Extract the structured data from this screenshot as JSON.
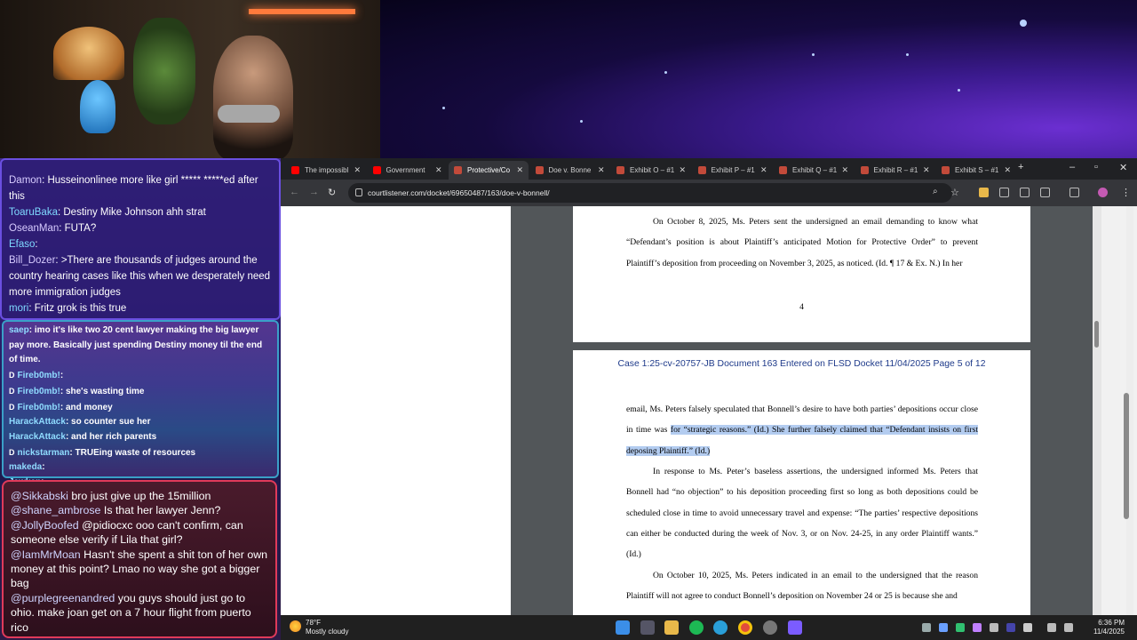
{
  "chat": {
    "top": [
      {
        "user": "Damon",
        "msg": "Husseinonlinee more like girl ***** *****ed after this"
      },
      {
        "user": "ToaruBaka",
        "msg": "Destiny Mike Johnson ahh strat"
      },
      {
        "user": "OseanMan",
        "msg": "FUTA?"
      },
      {
        "user": "Efaso",
        "msg": ""
      },
      {
        "user": "Bill_Dozer",
        "msg": ">There are thousands of judges around the country hearing cases like this when we desperately need more immigration judges"
      },
      {
        "user": "mori",
        "msg": "Fritz grok is this true"
      }
    ],
    "mid": [
      {
        "user": "saep",
        "msg": "imo it's like two 20 cent lawyer making the big lawyer pay more. Basically just spending Destiny money til the end of time.",
        "badge": ""
      },
      {
        "user": "Fireb0mb!",
        "msg": "",
        "badge": "D"
      },
      {
        "user": "Fireb0mb!",
        "msg": "she's wasting time",
        "badge": "D"
      },
      {
        "user": "Fireb0mb!",
        "msg": "and money",
        "badge": "D"
      },
      {
        "user": "HarackAttack",
        "msg": "so counter sue her",
        "badge": ""
      },
      {
        "user": "HarackAttack",
        "msg": "and her rich parents",
        "badge": ""
      },
      {
        "user": "nickstarman",
        "msg": "TRUEing waste of resources",
        "badge": "D"
      },
      {
        "user": "makeda",
        "msg": "",
        "badge": ""
      },
      {
        "user": "Jawken",
        "msg": "",
        "badge": ""
      }
    ],
    "bottom": [
      {
        "user": "@Sikkabski",
        "msg": "bro just give up the 15million"
      },
      {
        "user": "@shane_ambrose",
        "msg": "Is that her lawyer Jenn?"
      },
      {
        "user": "@JollyBoofed",
        "msg": "@pidiocxc ooo can't confirm, can someone else verify if Lila that girl?"
      },
      {
        "user": "@IamMrMoan",
        "msg": "Hasn't she spent a shit ton of her own money at this point? Lmao no way she got a bigger bag"
      },
      {
        "user": "@purplegreenandred",
        "msg": "you guys should just go to ohio. make joan get on a 7 hour flight from puerto rico"
      }
    ]
  },
  "browser": {
    "tabs": [
      {
        "title": "The impossibl",
        "icon": "youtube-icon",
        "color": "#ff0000",
        "active": false
      },
      {
        "title": "Government",
        "icon": "youtube-icon",
        "color": "#ff0000",
        "active": false
      },
      {
        "title": "Protective/Co",
        "icon": "courtlistener-icon",
        "color": "#c24a3a",
        "active": true
      },
      {
        "title": "Doe v. Bonne",
        "icon": "courtlistener-icon",
        "color": "#c24a3a",
        "active": false
      },
      {
        "title": "Exhibit O – #1",
        "icon": "courtlistener-icon",
        "color": "#c24a3a",
        "active": false
      },
      {
        "title": "Exhibit P – #1",
        "icon": "courtlistener-icon",
        "color": "#c24a3a",
        "active": false
      },
      {
        "title": "Exhibit Q – #1",
        "icon": "courtlistener-icon",
        "color": "#c24a3a",
        "active": false
      },
      {
        "title": "Exhibit R – #1",
        "icon": "courtlistener-icon",
        "color": "#c24a3a",
        "active": false
      },
      {
        "title": "Exhibit S – #1",
        "icon": "courtlistener-icon",
        "color": "#c24a3a",
        "active": false
      }
    ],
    "new_tab": "+",
    "url": "courtlistener.com/docket/69650487/163/doe-v-bonnell/"
  },
  "pdf": {
    "page4_text": "On October 8, 2025, Ms. Peters sent the undersigned an email demanding to know what “Defendant’s position is about Plaintiff’s anticipated Motion for Protective Order” to prevent Plaintiff’s deposition from proceeding on November 3, 2025, as noticed. (Id. ¶ 17 & Ex. N.) In her",
    "page4_number": "4",
    "page5_header": "Case 1:25-cv-20757-JB   Document 163   Entered on FLSD Docket 11/04/2025   Page 5 of 12",
    "p5_para1_a": "email, Ms. Peters falsely speculated that Bonnell’s desire to have both parties’ depositions occur close in time was ",
    "p5_para1_hl": "for “strategic reasons.” (Id.) She further falsely claimed that “Defendant insists on first deposing Plaintiff.” (Id.)",
    "p5_para2": "In response to Ms. Peter’s baseless assertions, the undersigned informed Ms. Peters that Bonnell had “no objection” to his deposition proceeding first so long as both depositions could be scheduled close in time to avoid unnecessary travel and expense: “The parties’ respective depositions can either be conducted during the week of Nov. 3, or on Nov. 24-25, in any order Plaintiff wants.” (Id.)",
    "p5_para3": "On October 10, 2025, Ms. Peters indicated in an email to the undersigned that the reason Plaintiff will not agree to conduct Bonnell’s deposition on November 24 or 25 is because she and"
  },
  "taskbar": {
    "temp": "78°F",
    "weather": "Mostly cloudy",
    "time": "6:36 PM",
    "date": "11/4/2025"
  },
  "colors": {
    "accent_chat_top": "#6a4fe0",
    "accent_chat_mid": "#3aa0c8",
    "accent_chat_bottom": "#e03a5a",
    "highlight": "#b3ccf0"
  }
}
